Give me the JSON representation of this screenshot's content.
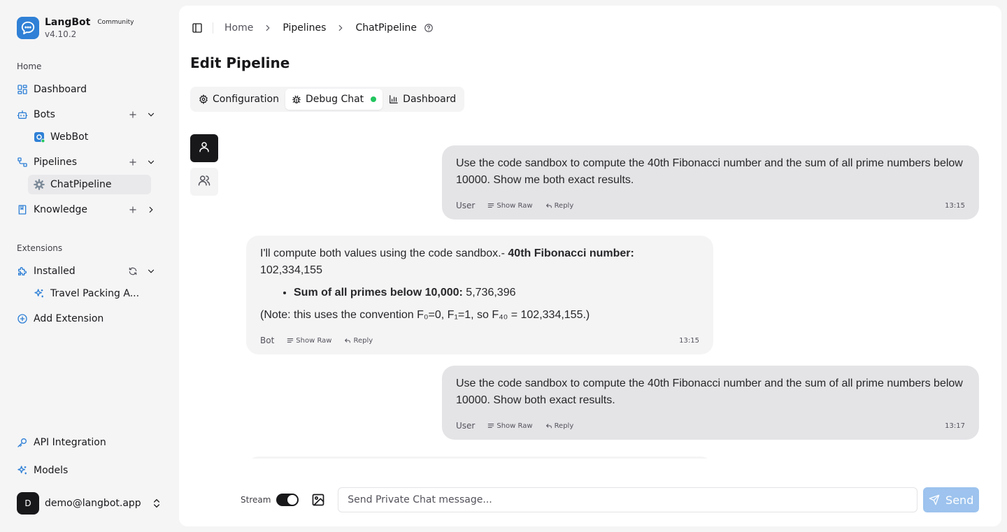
{
  "brand": {
    "name": "LangBot",
    "badge": "Community",
    "version": "v4.10.2"
  },
  "sidebar": {
    "section_home": "Home",
    "dashboard": "Dashboard",
    "bots": "Bots",
    "bot_items": [
      "WebBot"
    ],
    "pipelines": "Pipelines",
    "pipeline_items": [
      "ChatPipeline"
    ],
    "knowledge": "Knowledge",
    "section_extensions": "Extensions",
    "installed": "Installed",
    "installed_items": [
      "Travel Packing A..."
    ],
    "add_extension": "Add Extension",
    "api_integration": "API Integration",
    "models": "Models",
    "user_initial": "D",
    "user_email": "demo@langbot.app"
  },
  "breadcrumb": {
    "home": "Home",
    "pipelines": "Pipelines",
    "current": "ChatPipeline"
  },
  "page": {
    "title": "Edit Pipeline"
  },
  "tabs": {
    "configuration": "Configuration",
    "debug_chat": "Debug Chat",
    "dashboard": "Dashboard",
    "active": "Debug Chat"
  },
  "messages": [
    {
      "role": "User",
      "text": "Use the code sandbox to compute the 40th Fibonacci number and the sum of all prime numbers below 10000. Show me both exact results.",
      "show_raw": "Show Raw",
      "reply": "Reply",
      "time": "13:15"
    },
    {
      "role": "Bot",
      "intro": "I'll compute both values using the code sandbox.- ",
      "fib_label": "40th Fibonacci number:",
      "fib_value": " 102,334,155",
      "prime_label": "Sum of all primes below 10,000:",
      "prime_value": " 5,736,396",
      "note": "(Note: this uses the convention F₀=0, F₁=1, so F₄₀ = 102,334,155.)",
      "show_raw": "Show Raw",
      "reply": "Reply",
      "time": "13:15"
    },
    {
      "role": "User",
      "text": "Use the code sandbox to compute the 40th Fibonacci number and the sum of all prime numbers below 10000. Show both exact results.",
      "show_raw": "Show Raw",
      "reply": "Reply",
      "time": "13:17"
    }
  ],
  "input": {
    "stream_label": "Stream",
    "stream_on": true,
    "placeholder": "Send Private Chat message...",
    "send_label": "Send"
  },
  "colors": {
    "accent": "#2f80d6",
    "send_disabled": "#9dc3ee",
    "status_dot": "#22c55e"
  }
}
